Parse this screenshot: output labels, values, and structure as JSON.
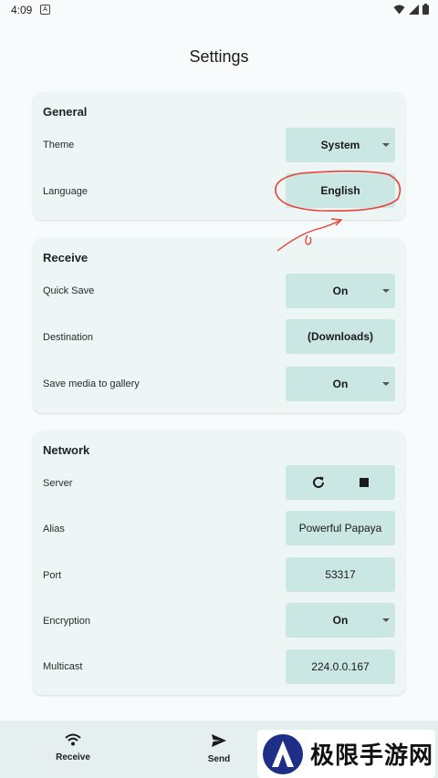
{
  "status": {
    "time": "4:09"
  },
  "page": {
    "title": "Settings"
  },
  "general": {
    "heading": "General",
    "theme": {
      "label": "Theme",
      "value": "System"
    },
    "language": {
      "label": "Language",
      "value": "English"
    }
  },
  "receive": {
    "heading": "Receive",
    "quick_save": {
      "label": "Quick Save",
      "value": "On"
    },
    "destination": {
      "label": "Destination",
      "value": "(Downloads)"
    },
    "save_media": {
      "label": "Save media to gallery",
      "value": "On"
    }
  },
  "network": {
    "heading": "Network",
    "server": {
      "label": "Server"
    },
    "alias": {
      "label": "Alias",
      "value": "Powerful Papaya"
    },
    "port": {
      "label": "Port",
      "value": "53317"
    },
    "encryption": {
      "label": "Encryption",
      "value": "On"
    },
    "multicast": {
      "label": "Multicast",
      "value": "224.0.0.167"
    }
  },
  "nav": {
    "receive": {
      "label": "Receive",
      "icon": "wifi-icon"
    },
    "send": {
      "label": "Send",
      "icon": "send-icon"
    }
  },
  "watermark": {
    "text": "极限手游网"
  },
  "colors": {
    "card": "#eef6f5",
    "control": "#cbe7e4",
    "annotation": "#e8423a",
    "logo": "#1f2f87"
  }
}
